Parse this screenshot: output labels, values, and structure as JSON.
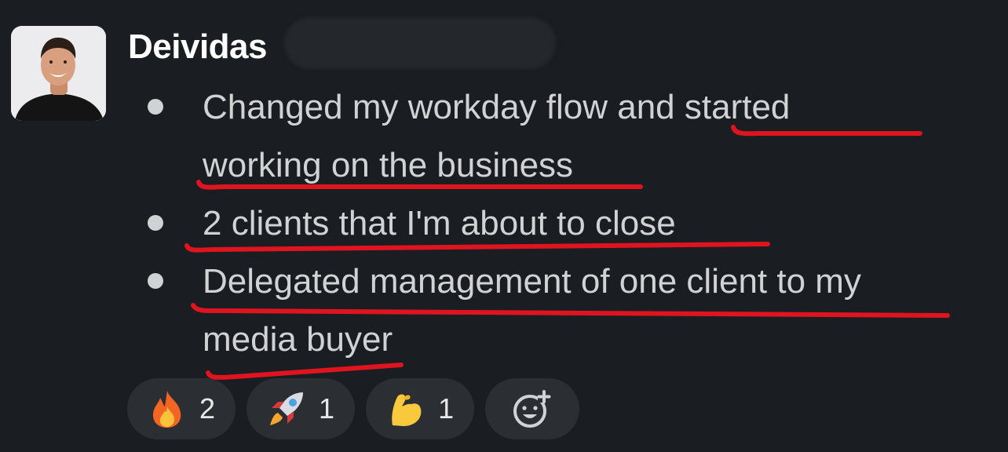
{
  "message": {
    "author": "Deividas",
    "bullets": [
      {
        "lines": [
          "Changed my workday flow and started",
          "working on the business"
        ]
      },
      {
        "lines": [
          "2 clients that I'm about to close"
        ]
      },
      {
        "lines": [
          "Delegated management of one client to my",
          "media buyer"
        ]
      }
    ]
  },
  "reactions": [
    {
      "emoji": "fire-emoji",
      "count": "2"
    },
    {
      "emoji": "rocket-emoji",
      "count": "1"
    },
    {
      "emoji": "flexed-biceps-emoji",
      "count": "1"
    }
  ],
  "colors": {
    "background": "#1a1d21",
    "text": "#d1d2d3",
    "annotation": "#e0141e",
    "pill": "#2b2e33"
  }
}
